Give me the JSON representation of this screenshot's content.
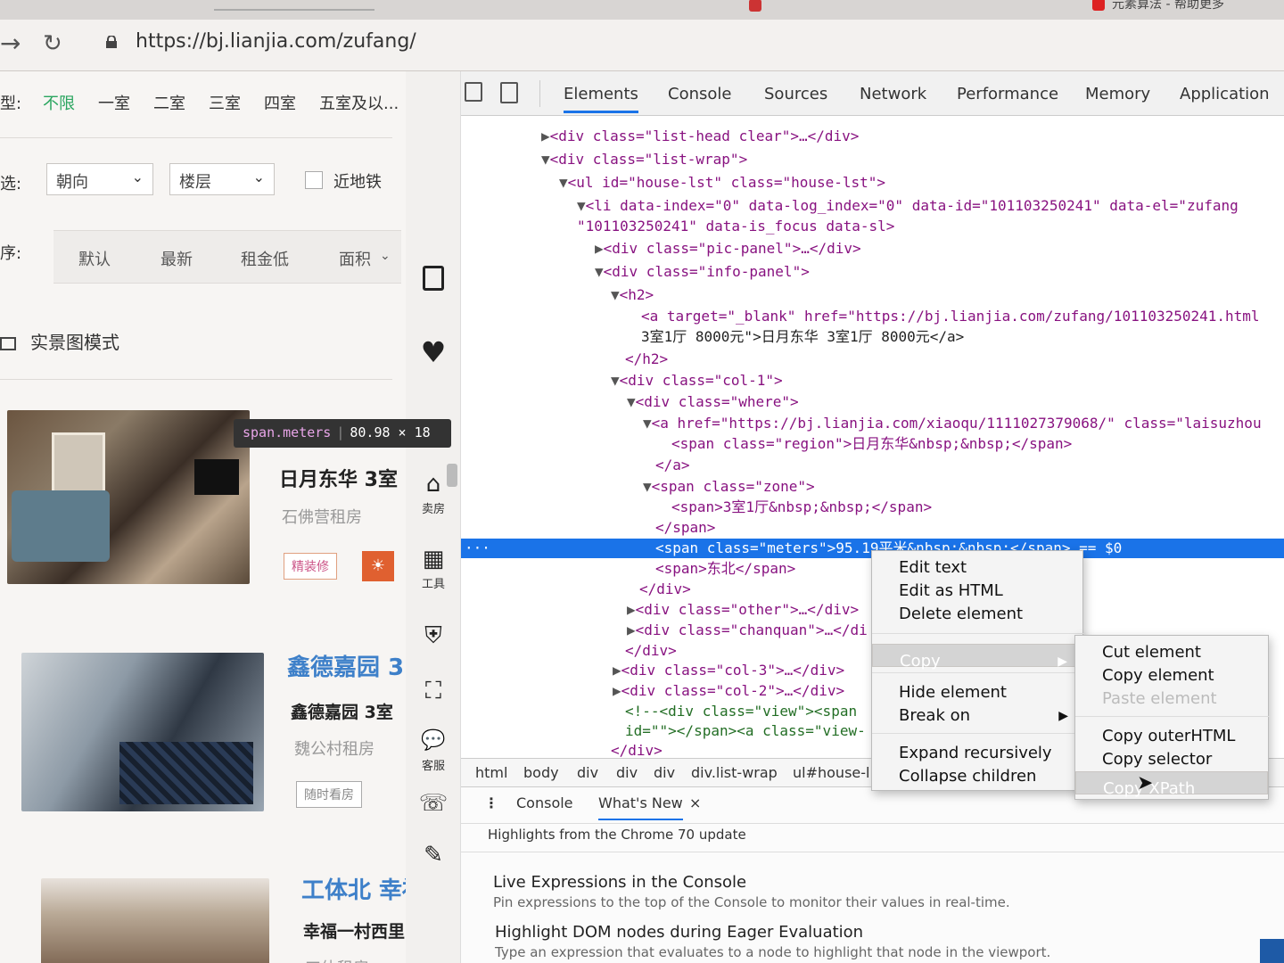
{
  "browser": {
    "url": "https://bj.lianjia.com/zufang/",
    "tabs": [
      "元素算法 - 帮助更多"
    ]
  },
  "filters": {
    "room_label": "型:",
    "room_options": [
      "不限",
      "一室",
      "二室",
      "三室",
      "四室",
      "五室及以..."
    ],
    "more_label": "选:",
    "orientation": "朝向",
    "floor": "楼层",
    "near_subway": "近地铁",
    "sort_label": "序:",
    "sort_options": [
      "默认",
      "最新",
      "租金低",
      "面积"
    ]
  },
  "view_mode": "实景图模式",
  "listings": [
    {
      "title": "日月东华 3室",
      "subtitle": "石佛营租房",
      "tag": "精装修"
    },
    {
      "title_top": "鑫德嘉园 3",
      "title": "鑫德嘉园 3室",
      "subtitle": "魏公村租房",
      "tag": "随时看房"
    },
    {
      "title_top": "工体北 幸福",
      "title": "幸福一村西里",
      "subtitle": "工体租房"
    }
  ],
  "sidebar": {
    "sell": "卖房",
    "tools": "工具",
    "service": "客服"
  },
  "tooltip": {
    "selector": "span.meters",
    "size": "80.98 × 18"
  },
  "devtools": {
    "tabs": [
      "Elements",
      "Console",
      "Sources",
      "Network",
      "Performance",
      "Memory",
      "Application"
    ],
    "active_tab": "Elements",
    "breadcrumbs": [
      "html",
      "body",
      "div",
      "div",
      "div",
      "div.list-wrap",
      "ul#house-l"
    ],
    "drawer_tabs": [
      "Console",
      "What's New"
    ],
    "drawer_header": "Highlights from the Chrome 70 update",
    "whats_new": [
      {
        "title": "Live Expressions in the Console",
        "desc": "Pin expressions to the top of the Console to monitor their values in real-time."
      },
      {
        "title": "Highlight DOM nodes during Eager Evaluation",
        "desc": "Type an expression that evaluates to a node to highlight that node in the viewport."
      }
    ],
    "dom_lines": [
      "<div class=\"list-head clear\">…</div>",
      "<div class=\"list-wrap\">",
      "<ul id=\"house-lst\" class=\"house-lst\">",
      "<li data-index=\"0\" data-log_index=\"0\" data-id=\"101103250241\" data-el=\"zufang",
      "\"101103250241\" data-is_focus data-sl>",
      "<div class=\"pic-panel\">…</div>",
      "<div class=\"info-panel\">",
      "<h2>",
      "<a target=\"_blank\" href=\"https://bj.lianjia.com/zufang/101103250241.html",
      "3室1厅 8000元\">日月东华 3室1厅 8000元</a>",
      "</h2>",
      "<div class=\"col-1\">",
      "<div class=\"where\">",
      "<a href=\"https://bj.lianjia.com/xiaoqu/1111027379068/\" class=\"laisuzhou",
      "<span class=\"region\">日月东华&nbsp;&nbsp;</span>",
      "</a>",
      "<span class=\"zone\">",
      "<span>3室1厅&nbsp;&nbsp;</span>",
      "</span>",
      "<span class=\"meters\">95.19平米&nbsp;&nbsp;</span> == $0",
      "<span>东北</span>",
      "</div>",
      "<div class=\"other\">…</div>",
      "<div class=\"chanquan\">…</di",
      "</div>",
      "<div class=\"col-3\">…</div>",
      "<div class=\"col-2\">…</div>",
      "<!--<div class=\"view\"><span",
      "id=\"\"></span><a class=\"view-",
      "</div>"
    ]
  },
  "context_menu": {
    "items": [
      "Edit text",
      "Edit as HTML",
      "Delete element",
      "Copy",
      "Hide element",
      "Break on",
      "Expand recursively",
      "Collapse children"
    ],
    "copy_submenu": [
      "Cut element",
      "Copy element",
      "Paste element",
      "Copy outerHTML",
      "Copy selector",
      "Copy XPath"
    ]
  },
  "colors": {
    "accent": "#1a73e8",
    "filter_active": "#2aa55f",
    "listing_blue": "#3e80c9"
  }
}
